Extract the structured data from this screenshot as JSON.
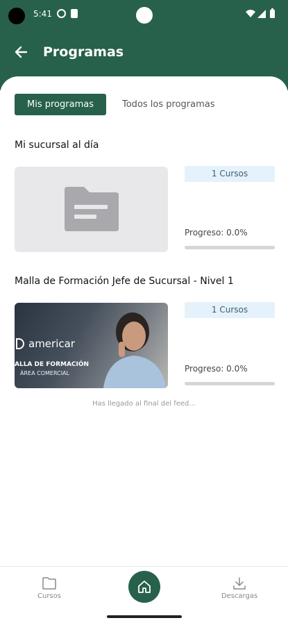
{
  "status_bar": {
    "time": "5:41"
  },
  "header": {
    "title": "Programas"
  },
  "tabs": [
    {
      "label": "Mis programas",
      "active": true
    },
    {
      "label": "Todos los programas",
      "active": false
    }
  ],
  "programs": [
    {
      "title": "Mi sucursal al día",
      "thumbnail_icon": "folder-icon",
      "courses_badge": "1 Cursos",
      "progress_label": "Progreso: 0.0%",
      "progress_value": 0.0
    },
    {
      "title": "Malla de Formación Jefe de Sucursal - Nivel 1",
      "thumbnail_brand": "americar",
      "thumbnail_line1": "ALLA DE FORMACIÓN",
      "thumbnail_line2": "ÁREA COMERCIAL",
      "courses_badge": "1 Cursos",
      "progress_label": "Progreso: 0.0%",
      "progress_value": 0.0
    }
  ],
  "feed_end_text": "Has llegado al final del feed...",
  "bottom_nav": {
    "left": {
      "label": "Cursos",
      "icon": "folder-icon"
    },
    "center": {
      "icon": "home-icon"
    },
    "right": {
      "label": "Descargas",
      "icon": "download-icon"
    }
  },
  "colors": {
    "primary": "#27614b",
    "badge_bg": "#e5f2fb",
    "placeholder_bg": "#e8e8ea"
  }
}
